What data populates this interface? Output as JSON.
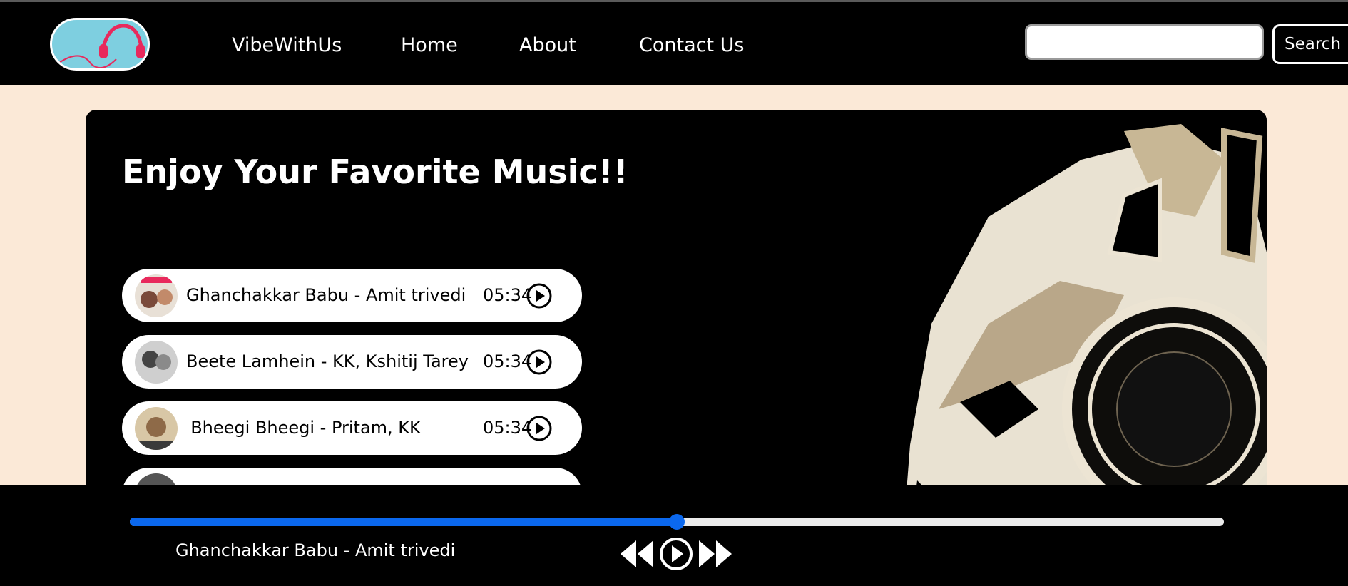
{
  "nav": {
    "brand": "VibeWithUs",
    "links": [
      "Home",
      "About",
      "Contact Us"
    ],
    "search_value": "",
    "search_button": "Search"
  },
  "hero": {
    "title": "Enjoy Your Favorite Music!!"
  },
  "songs": [
    {
      "title": "Ghanchakkar Babu - Amit trivedi",
      "duration": "05:34"
    },
    {
      "title": "Beete Lamhein - KK, Kshitij Tarey",
      "duration": "05:34"
    },
    {
      "title": "Bheegi Bheegi - Pritam, KK",
      "duration": "05:34"
    },
    {
      "title": "",
      "duration": ""
    }
  ],
  "player": {
    "now_playing": "Ghanchakkar Babu - Amit trivedi",
    "progress_fraction": 0.5
  },
  "colors": {
    "navbar": "#000000",
    "page_bg": "#fbe9d7",
    "accent": "#0b68ee",
    "track": "#ebebeb"
  },
  "icons": [
    "headphones-icon",
    "play-circle-icon",
    "previous-icon",
    "next-icon"
  ]
}
